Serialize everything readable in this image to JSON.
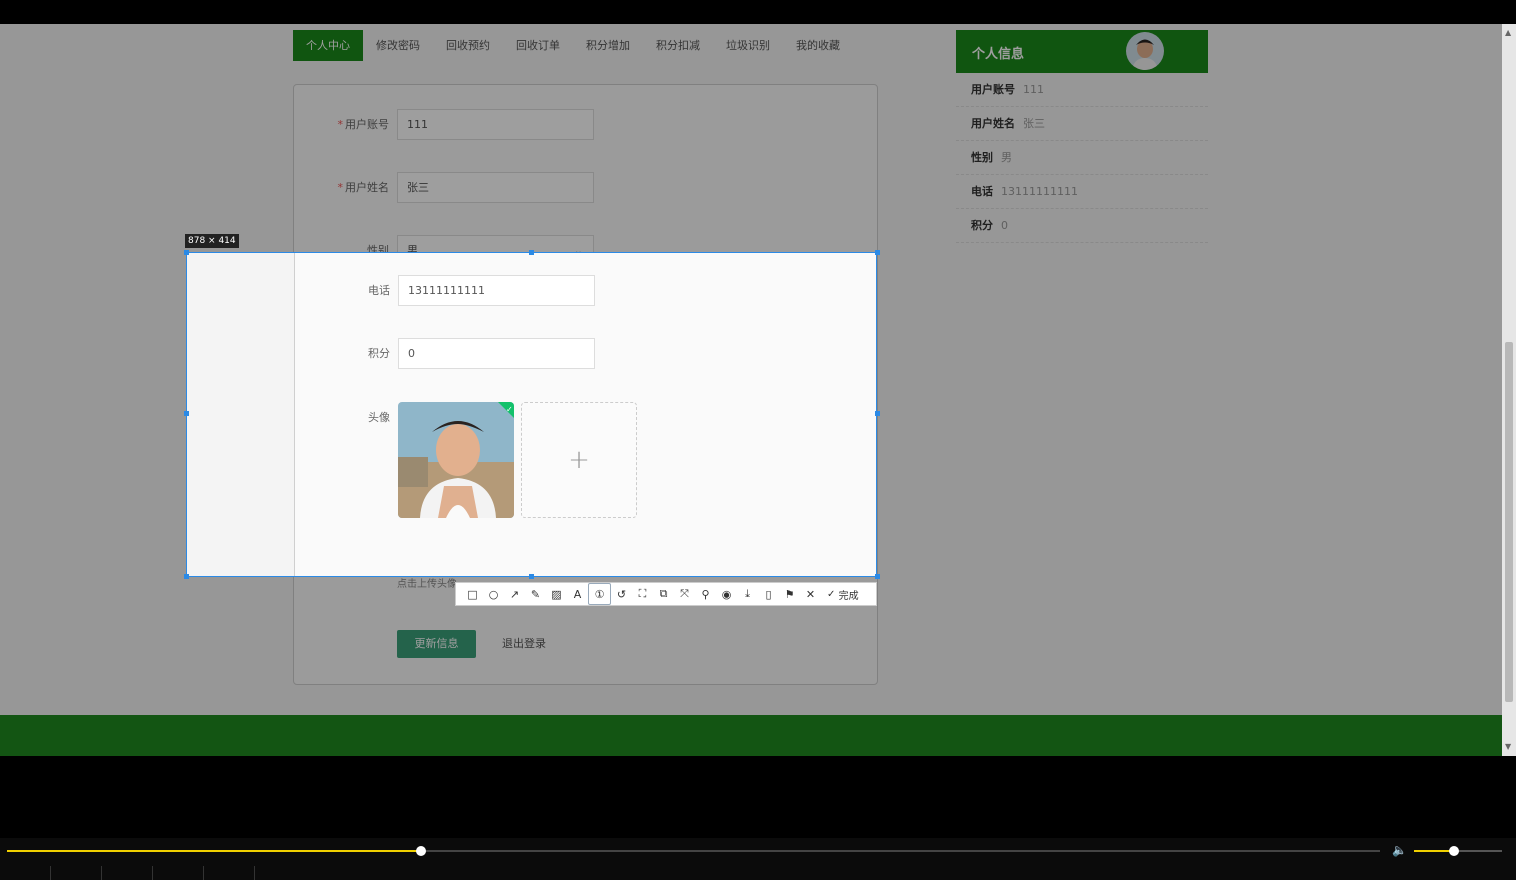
{
  "tabs": [
    {
      "label": "个人中心",
      "active": true
    },
    {
      "label": "修改密码"
    },
    {
      "label": "回收预约"
    },
    {
      "label": "回收订单"
    },
    {
      "label": "积分增加"
    },
    {
      "label": "积分扣减"
    },
    {
      "label": "垃圾识别"
    },
    {
      "label": "我的收藏"
    }
  ],
  "form": {
    "account_label": "用户账号",
    "account_value": "111",
    "name_label": "用户姓名",
    "name_value": "张三",
    "gender_label": "性别",
    "gender_value": "男",
    "phone_label": "电话",
    "phone_value": "13111111111",
    "points_label": "积分",
    "points_value": "0",
    "avatar_label": "头像",
    "upload_hint": "点击上传头像",
    "update_button": "更新信息",
    "logout_button": "退出登录"
  },
  "side": {
    "title": "个人信息",
    "rows": [
      {
        "k": "用户账号",
        "v": "111"
      },
      {
        "k": "用户姓名",
        "v": "张三"
      },
      {
        "k": "性别",
        "v": "男"
      },
      {
        "k": "电话",
        "v": "13111111111"
      },
      {
        "k": "积分",
        "v": "0"
      }
    ]
  },
  "capture": {
    "size_text": "878 × 414",
    "done_label": "完成"
  },
  "player": {
    "progress": 0.3,
    "volume": 0.45
  },
  "colors": {
    "brand_green": "#1a8a1a",
    "selection_blue": "#2b8ae6",
    "progress_yellow": "#f0d000"
  }
}
